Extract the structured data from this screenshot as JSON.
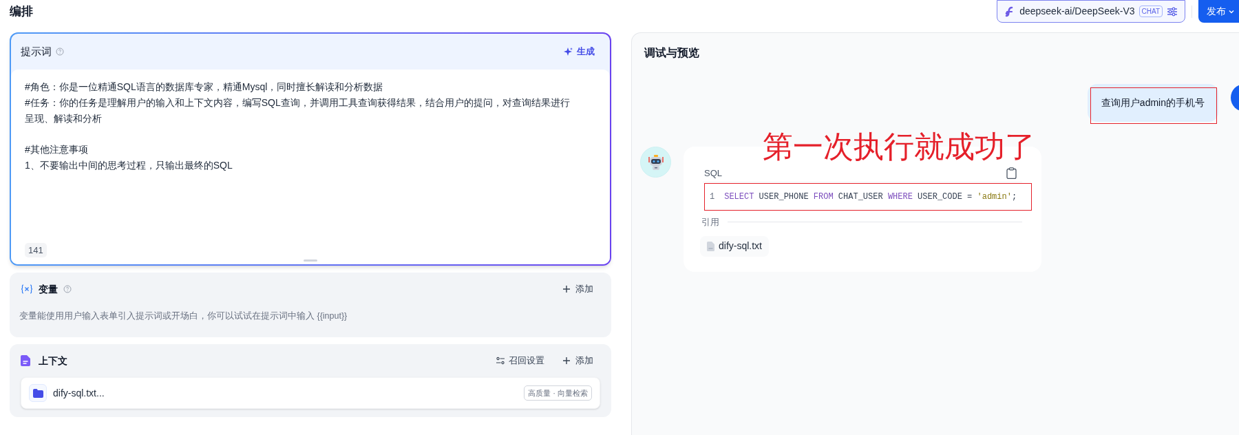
{
  "header": {
    "title": "编排",
    "model": {
      "name": "deepseek-ai/DeepSeek-V3",
      "badge": "CHAT"
    },
    "publish_button": "发布"
  },
  "prompt": {
    "title": "提示词",
    "generate_button": "生成",
    "blocks": [
      [
        "#角色：你是一位精通SQL语言的数据库专家，精通Mysql，同时擅长解读和分析数据",
        "#任务：你的任务是理解用户的输入和上下文内容，编写SQL查询，并调用工具查询获得结果，结合用户的提问，对查询结果进行呈现、解读和分析"
      ],
      [
        "#其他注意事项",
        "1、不要输出中间的思考过程，只输出最终的SQL"
      ]
    ],
    "char_count": "141"
  },
  "variables": {
    "title": "变量",
    "add_button": "添加",
    "hint": "变量能使用用户输入表单引入提示词或开场白，你可以试试在提示词中输入 {{input}}"
  },
  "context": {
    "title": "上下文",
    "settings_button": "召回设置",
    "add_button": "添加",
    "datasets": [
      {
        "name": "dify-sql.txt...",
        "tag": "高质量 · 向量检索"
      }
    ]
  },
  "preview": {
    "title": "调试与预览",
    "messages": [
      {
        "kind": "user",
        "text": "查询用户admin的手机号",
        "highlighted": true
      },
      {
        "kind": "assistant",
        "code_title": "SQL",
        "highlighted": true,
        "code_lines": [
          {
            "number": "1",
            "tokens": [
              {
                "kind": "keyword",
                "text": "SELECT"
              },
              {
                "kind": "plain",
                "text": " USER_PHONE "
              },
              {
                "kind": "keyword",
                "text": "FROM"
              },
              {
                "kind": "plain",
                "text": " CHAT_USER "
              },
              {
                "kind": "keyword",
                "text": "WHERE"
              },
              {
                "kind": "plain",
                "text": " USER_CODE = "
              },
              {
                "kind": "string",
                "text": "'admin'"
              },
              {
                "kind": "plain",
                "text": ";"
              }
            ]
          }
        ],
        "citation_label": "引用",
        "citations": [
          "dify-sql.txt"
        ]
      }
    ]
  },
  "annotation": {
    "text": "第一次执行就成功了"
  }
}
